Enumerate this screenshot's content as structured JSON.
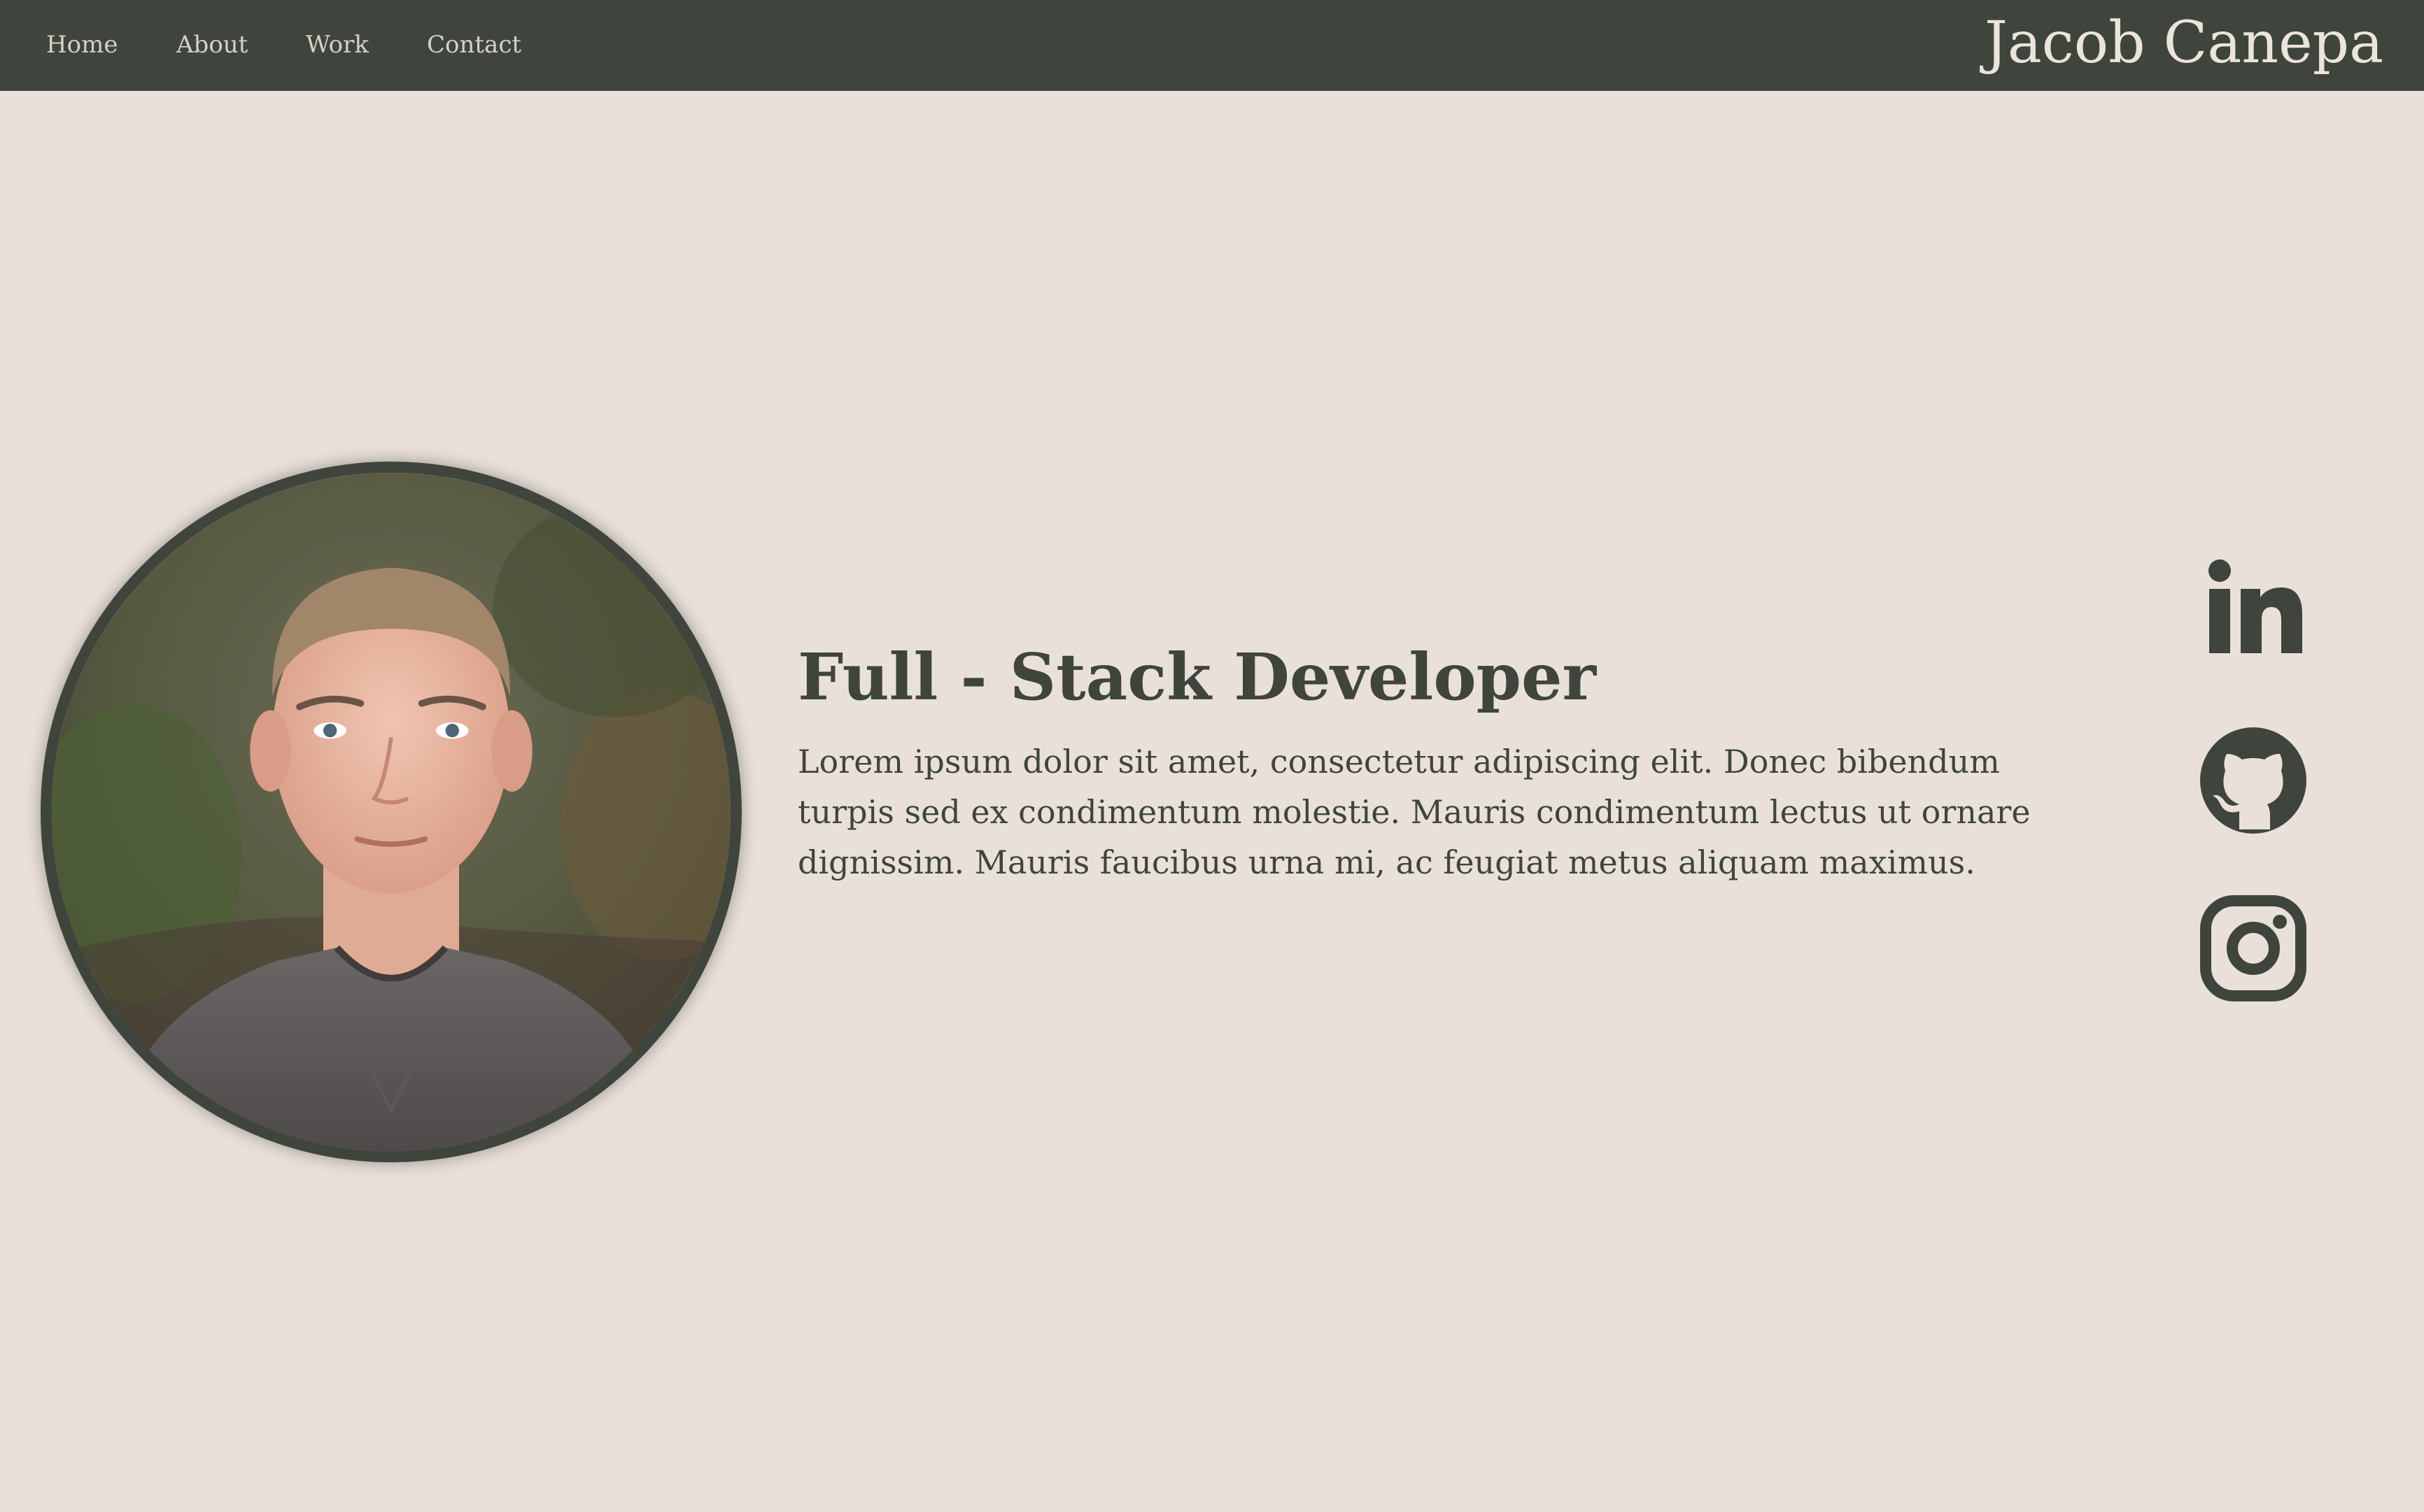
{
  "nav": {
    "links": [
      "Home",
      "About",
      "Work",
      "Contact"
    ],
    "brand": "Jacob Canepa"
  },
  "hero": {
    "headline": "Full - Stack Developer",
    "bio": "Lorem ipsum dolor sit amet, consectetur adipiscing elit. Donec bibendum turpis sed ex condimentum molestie. Mauris condimentum lectus ut ornare dignissim. Mauris faucibus urna mi, ac feugiat metus aliquam maximus."
  },
  "social": {
    "icons": [
      "linkedin-icon",
      "github-icon",
      "instagram-icon"
    ]
  },
  "colors": {
    "background": "#e9e1d9",
    "nav_background": "#3f453d",
    "text_primary": "#3f453d",
    "nav_text": "#d7d0c6",
    "brand_text": "#ebe4da"
  }
}
